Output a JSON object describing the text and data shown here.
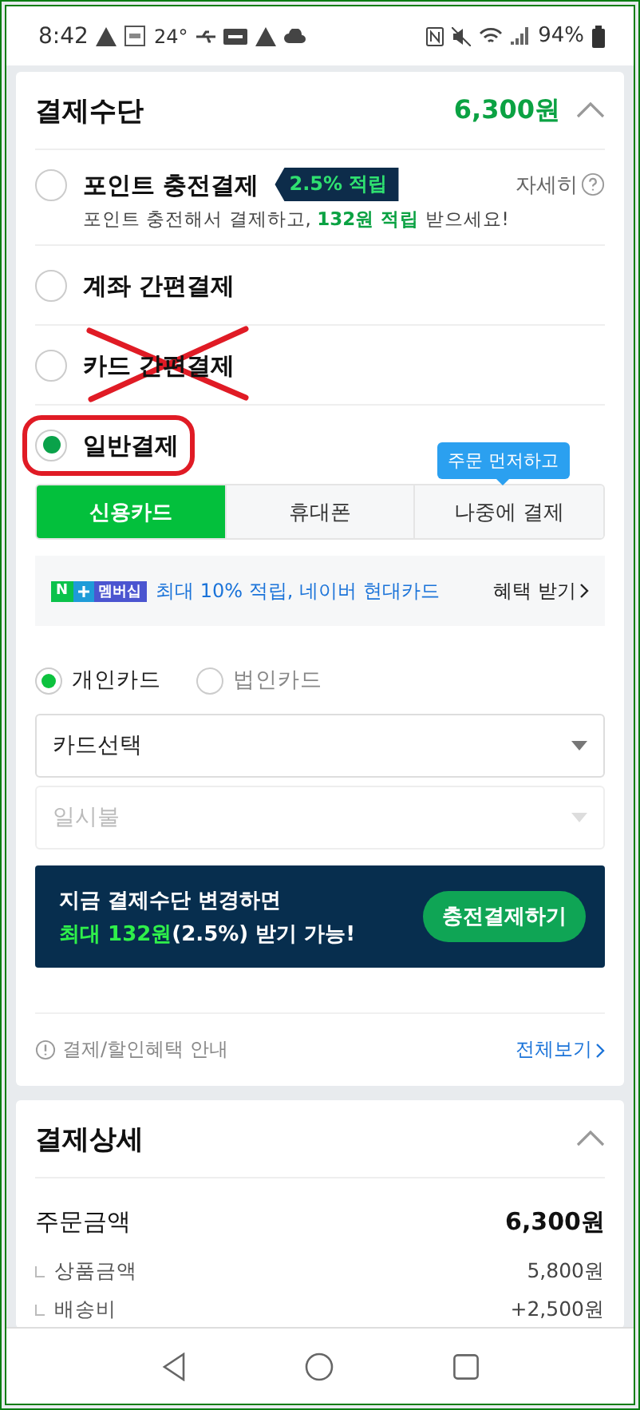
{
  "status_bar": {
    "time": "8:42",
    "temperature": "24°",
    "battery": "94%"
  },
  "payment_methods": {
    "title": "결제수단",
    "amount": "6,300원",
    "expanded": true,
    "options": [
      {
        "kind": "point",
        "label": "포인트 충전결제",
        "badge": "2.5% 적립",
        "detail": "자세히",
        "description": "포인트 충전해서 결제하고, **132원 적립** 받으세요!",
        "selected": false,
        "crossed_out": false,
        "circled": false
      },
      {
        "kind": "plain",
        "label": "계좌 간편결제",
        "selected": false,
        "crossed_out": false,
        "circled": false
      },
      {
        "kind": "plain",
        "label": "카드 간편결제",
        "selected": false,
        "crossed_out": true,
        "circled": false
      },
      {
        "kind": "plain",
        "label": "일반결제",
        "selected": true,
        "crossed_out": false,
        "circled": true
      }
    ],
    "tooltip": "주문 먼저하고",
    "tabs": [
      {
        "label": "신용카드",
        "selected": true
      },
      {
        "label": "휴대폰",
        "selected": false
      },
      {
        "label": "나중에 결제",
        "selected": false
      }
    ],
    "promo": {
      "badge_letter": "N",
      "badge_text": "멤버십",
      "text": "최대 10% 적립, 네이버 현대카드",
      "link": "혜택 받기"
    },
    "card_types": [
      {
        "label": "개인카드",
        "selected": true
      },
      {
        "label": "법인카드",
        "selected": false
      }
    ],
    "selects": [
      {
        "value": "카드선택",
        "disabled": false
      },
      {
        "placeholder": "일시불",
        "disabled": true
      }
    ],
    "banner": {
      "line1": "지금 결제수단 변경하면",
      "line2": "**최대 132원**(2.5%) 받기 가능!",
      "button": "충전결제하기"
    },
    "footer": {
      "info": "결제/할인혜택 안내",
      "link": "전체보기"
    }
  },
  "payment_details": {
    "title": "결제상세",
    "expanded": true,
    "rows": [
      {
        "kind": "total",
        "label": "주문금액",
        "value": "6,300원"
      },
      {
        "kind": "sub",
        "label": "상품금액",
        "value": "5,800원"
      },
      {
        "kind": "sub",
        "label": "배송비",
        "value": "+2,500원"
      }
    ]
  }
}
